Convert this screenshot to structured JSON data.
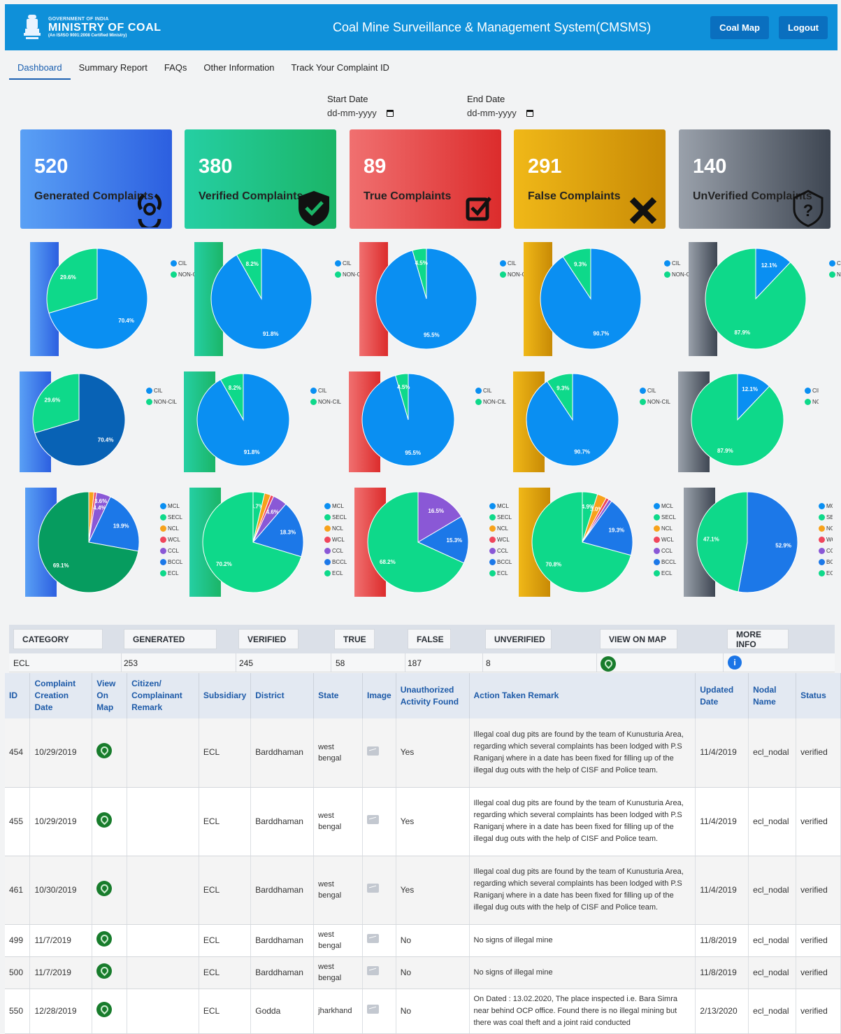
{
  "header": {
    "gov_line": "GOVERNMENT OF INDIA",
    "ministry": "MINISTRY OF COAL",
    "iso_line": "(An IS/ISO 9001:2008 Certified Ministry)",
    "title": "Coal Mine Surveillance & Management System(CMSMS)",
    "coal_map": "Coal Map",
    "logout": "Logout"
  },
  "nav": [
    "Dashboard",
    "Summary Report",
    "FAQs",
    "Other Information",
    "Track Your Complaint ID"
  ],
  "dates": {
    "start_label": "Start Date",
    "start_value": "dd-mm-yyyy",
    "end_label": "End Date",
    "end_value": "dd-mm-yyyy"
  },
  "cards": [
    {
      "num": "520",
      "label": "Generated Complaints",
      "icon": "biohazard-icon"
    },
    {
      "num": "380",
      "label": "Verified Complaints",
      "icon": "shield-check-icon"
    },
    {
      "num": "89",
      "label": "True Complaints",
      "icon": "checkbox-icon"
    },
    {
      "num": "291",
      "label": "False Complaints",
      "icon": "x-icon"
    },
    {
      "num": "140",
      "label": "UnVerified Complaints",
      "icon": "question-shield-icon"
    }
  ],
  "colors": {
    "CIL": "#0a8ff2",
    "NON-CIL": "#0ed98a",
    "MCL": "#0a8ff2",
    "SECL": "#0ed98a",
    "NCL": "#f7a21b",
    "WCL": "#f0465c",
    "CCL": "#8a58d6",
    "BCCL": "#1c78e8",
    "ECL": "#0ed98a"
  },
  "pie_rows": [
    [
      {
        "slices": [
          {
            "name": "CIL",
            "value": 70.4
          },
          {
            "name": "NON-CIL",
            "value": 29.6
          }
        ]
      },
      {
        "slices": [
          {
            "name": "CIL",
            "value": 91.8
          },
          {
            "name": "NON-CIL",
            "value": 8.2
          }
        ]
      },
      {
        "slices": [
          {
            "name": "CIL",
            "value": 95.5
          },
          {
            "name": "NON-CIL",
            "value": 4.5
          }
        ]
      },
      {
        "slices": [
          {
            "name": "CIL",
            "value": 90.7
          },
          {
            "name": "NON-CIL",
            "value": 9.3
          }
        ]
      },
      {
        "slices": [
          {
            "name": "CIL",
            "value": 12.1
          },
          {
            "name": "NON-CIL",
            "value": 87.9
          }
        ]
      }
    ],
    [
      {
        "slices": [
          {
            "name": "CIL",
            "value": 70.4
          },
          {
            "name": "NON-CIL",
            "value": 29.6
          }
        ]
      },
      {
        "slices": [
          {
            "name": "CIL",
            "value": 91.8
          },
          {
            "name": "NON-CIL",
            "value": 8.2
          }
        ]
      },
      {
        "slices": [
          {
            "name": "CIL",
            "value": 95.5
          },
          {
            "name": "NON-CIL",
            "value": 4.5
          }
        ]
      },
      {
        "slices": [
          {
            "name": "CIL",
            "value": 90.7
          },
          {
            "name": "NON-CIL",
            "value": 9.3
          }
        ]
      },
      {
        "slices": [
          {
            "name": "CIL",
            "value": 12.1
          },
          {
            "name": "NON-CIL",
            "value": 87.9
          }
        ]
      }
    ],
    [
      {
        "slices": [
          {
            "name": "MCL",
            "value": 0
          },
          {
            "name": "SECL",
            "value": 0
          },
          {
            "name": "NCL",
            "value": 1.6
          },
          {
            "name": "WCL",
            "value": 0.8
          },
          {
            "name": "CCL",
            "value": 4.4
          },
          {
            "name": "BCCL",
            "value": 19.9
          },
          {
            "name": "ECL",
            "value": 69.1
          }
        ],
        "labels": [
          "",
          "",
          "",
          "",
          "4.4%",
          "19.9%",
          "69.1%"
        ],
        "extra_label": "3.6%"
      },
      {
        "slices": [
          {
            "name": "MCL",
            "value": 0
          },
          {
            "name": "SECL",
            "value": 3.7
          },
          {
            "name": "NCL",
            "value": 2.0
          },
          {
            "name": "WCL",
            "value": 1.0
          },
          {
            "name": "CCL",
            "value": 4.6
          },
          {
            "name": "BCCL",
            "value": 18.3
          },
          {
            "name": "ECL",
            "value": 70.2
          }
        ],
        "labels": [
          "",
          "3.7%",
          "",
          "",
          "4.6%",
          "18.3%",
          "70.2%"
        ]
      },
      {
        "slices": [
          {
            "name": "MCL",
            "value": 0
          },
          {
            "name": "SECL",
            "value": 0
          },
          {
            "name": "NCL",
            "value": 0
          },
          {
            "name": "WCL",
            "value": 0
          },
          {
            "name": "CCL",
            "value": 16.5
          },
          {
            "name": "BCCL",
            "value": 15.3
          },
          {
            "name": "ECL",
            "value": 68.2
          }
        ],
        "labels": [
          "",
          "",
          "",
          "",
          "16.5%",
          "15.3%",
          "68.2%"
        ]
      },
      {
        "slices": [
          {
            "name": "MCL",
            "value": 0
          },
          {
            "name": "SECL",
            "value": 4.9
          },
          {
            "name": "NCL",
            "value": 3.0
          },
          {
            "name": "WCL",
            "value": 1.0
          },
          {
            "name": "CCL",
            "value": 1.0
          },
          {
            "name": "BCCL",
            "value": 19.3
          },
          {
            "name": "ECL",
            "value": 70.8
          }
        ],
        "labels": [
          "",
          "4.9%",
          "3.0%",
          "",
          "",
          "19.3%",
          "70.8%"
        ]
      },
      {
        "slices": [
          {
            "name": "MCL",
            "value": 0
          },
          {
            "name": "SECL",
            "value": 0
          },
          {
            "name": "NCL",
            "value": 0
          },
          {
            "name": "WCL",
            "value": 0
          },
          {
            "name": "CCL",
            "value": 0
          },
          {
            "name": "BCCL",
            "value": 52.9
          },
          {
            "name": "ECL",
            "value": 47.1
          }
        ],
        "labels": [
          "",
          "",
          "",
          "",
          "",
          "52.9%",
          "47.1%"
        ]
      }
    ]
  ],
  "category_table": {
    "headers": [
      "CATEGORY",
      "GENERATED",
      "VERIFIED",
      "TRUE",
      "FALSE",
      "UNVERIFIED",
      "VIEW ON MAP",
      "MORE INFO"
    ],
    "row": [
      "ECL",
      "253",
      "245",
      "58",
      "187",
      "8"
    ]
  },
  "detail_table": {
    "headers": [
      "ID",
      "Complaint Creation Date",
      "View On Map",
      "Citizen/ Complainant Remark",
      "Subsidiary",
      "District",
      "State",
      "Image",
      "Unauthorized Activity Found",
      "Action Taken Remark",
      "Updated Date",
      "Nodal Name",
      "Status"
    ],
    "rows": [
      {
        "id": "454",
        "date": "10/29/2019",
        "remark": "",
        "sub": "ECL",
        "district": "Barddhaman",
        "state": "west bengal",
        "found": "Yes",
        "action": "Illegal coal dug pits are found by the team of Kunusturia Area, regarding which several complaints has been lodged with P.S Raniganj where in a date has been fixed for filling up of the illegal dug outs with the help of CISF and Police team.",
        "updated": "11/4/2019",
        "nodal": "ecl_nodal",
        "status": "verified"
      },
      {
        "id": "455",
        "date": "10/29/2019",
        "remark": "",
        "sub": "ECL",
        "district": "Barddhaman",
        "state": "west bengal",
        "found": "Yes",
        "action": "Illegal coal dug pits are found by the team of Kunusturia Area, regarding which several complaints has been lodged with P.S Raniganj where in a date has been fixed for filling up of the illegal dug outs with the help of CISF and Police team.",
        "updated": "11/4/2019",
        "nodal": "ecl_nodal",
        "status": "verified"
      },
      {
        "id": "461",
        "date": "10/30/2019",
        "remark": "",
        "sub": "ECL",
        "district": "Barddhaman",
        "state": "west bengal",
        "found": "Yes",
        "action": "Illegal coal dug pits are found by the team of Kunusturia Area, regarding which several complaints has been lodged with P.S Raniganj where in a date has been fixed for filling up of the illegal dug outs with the help of CISF and Police team.",
        "updated": "11/4/2019",
        "nodal": "ecl_nodal",
        "status": "verified"
      },
      {
        "id": "499",
        "date": "11/7/2019",
        "remark": "",
        "sub": "ECL",
        "district": "Barddhaman",
        "state": "west bengal",
        "found": "No",
        "action": "No signs of illegal mine",
        "updated": "11/8/2019",
        "nodal": "ecl_nodal",
        "status": "verified"
      },
      {
        "id": "500",
        "date": "11/7/2019",
        "remark": "",
        "sub": "ECL",
        "district": "Barddhaman",
        "state": "west bengal",
        "found": "No",
        "action": "No signs of illegal mine",
        "updated": "11/8/2019",
        "nodal": "ecl_nodal",
        "status": "verified"
      },
      {
        "id": "550",
        "date": "12/28/2019",
        "remark": "",
        "sub": "ECL",
        "district": "Godda",
        "state": "jharkhand",
        "found": "No",
        "action": "On Dated : 13.02.2020, The place inspected i.e. Bara Simra near behind OCP office. Found there is no illegal mining but there was coal theft and a joint raid conducted",
        "updated": "2/13/2020",
        "nodal": "ecl_nodal",
        "status": "verified"
      }
    ]
  }
}
